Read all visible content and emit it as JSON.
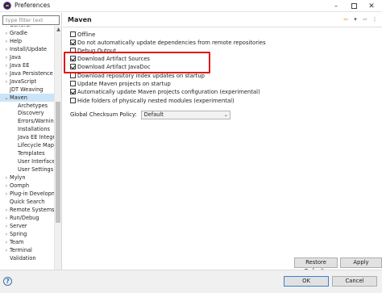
{
  "window": {
    "title": "Preferences"
  },
  "filter": {
    "placeholder": "type filter text"
  },
  "tree": {
    "items": [
      {
        "label": "General",
        "level": 0,
        "expandable": true
      },
      {
        "label": "Gradle",
        "level": 0,
        "expandable": true
      },
      {
        "label": "Help",
        "level": 0,
        "expandable": true
      },
      {
        "label": "Install/Update",
        "level": 0,
        "expandable": true
      },
      {
        "label": "Java",
        "level": 0,
        "expandable": true
      },
      {
        "label": "Java EE",
        "level": 0,
        "expandable": true
      },
      {
        "label": "Java Persistence",
        "level": 0,
        "expandable": true
      },
      {
        "label": "JavaScript",
        "level": 0,
        "expandable": true
      },
      {
        "label": "JDT Weaving",
        "level": 0,
        "expandable": false
      },
      {
        "label": "Maven",
        "level": 0,
        "expandable": true,
        "expanded": true,
        "selected": true
      },
      {
        "label": "Archetypes",
        "level": 1
      },
      {
        "label": "Discovery",
        "level": 1
      },
      {
        "label": "Errors/Warnings",
        "level": 1
      },
      {
        "label": "Installations",
        "level": 1
      },
      {
        "label": "Java EE Integrat",
        "level": 1
      },
      {
        "label": "Lifecycle Mappi",
        "level": 1
      },
      {
        "label": "Templates",
        "level": 1
      },
      {
        "label": "User Interface",
        "level": 1
      },
      {
        "label": "User Settings",
        "level": 1
      },
      {
        "label": "Mylyn",
        "level": 0,
        "expandable": true
      },
      {
        "label": "Oomph",
        "level": 0,
        "expandable": true
      },
      {
        "label": "Plug-in Developm",
        "level": 0,
        "expandable": true
      },
      {
        "label": "Quick Search",
        "level": 0,
        "expandable": false
      },
      {
        "label": "Remote Systems",
        "level": 0,
        "expandable": true
      },
      {
        "label": "Run/Debug",
        "level": 0,
        "expandable": true
      },
      {
        "label": "Server",
        "level": 0,
        "expandable": true
      },
      {
        "label": "Spring",
        "level": 0,
        "expandable": true
      },
      {
        "label": "Team",
        "level": 0,
        "expandable": true
      },
      {
        "label": "Terminal",
        "level": 0,
        "expandable": true
      },
      {
        "label": "Validation",
        "level": 0,
        "expandable": false
      }
    ]
  },
  "page": {
    "title": "Maven",
    "options": [
      {
        "label": "Offline",
        "checked": false
      },
      {
        "label": "Do not automatically update dependencies from remote repositories",
        "checked": true
      },
      {
        "label": "Debug Output",
        "checked": false
      },
      {
        "label": "Download Artifact Sources",
        "checked": true
      },
      {
        "label": "Download Artifact JavaDoc",
        "checked": true
      },
      {
        "label": "Download repository index updates on startup",
        "checked": false
      },
      {
        "label": "Update Maven projects on startup",
        "checked": false
      },
      {
        "label": "Automatically update Maven projects configuration (experimental)",
        "checked": true
      },
      {
        "label": "Hide folders of physically nested modules (experimental)",
        "checked": false
      }
    ],
    "checksum_label": "Global Checksum Policy:",
    "checksum_value": "Default"
  },
  "buttons": {
    "restore": "Restore Defaults",
    "apply": "Apply",
    "ok": "OK",
    "cancel": "Cancel"
  },
  "colors": {
    "highlight": "#e01a1a",
    "selection": "#cce4f7"
  }
}
